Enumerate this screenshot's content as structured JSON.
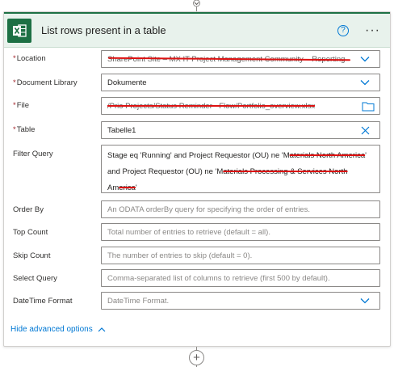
{
  "card": {
    "title": "List rows present in a table",
    "help_icon": "question-circle-icon",
    "more_icon": "ellipsis-icon",
    "accent_color": "#1d7044"
  },
  "fields": {
    "location": {
      "label": "Location",
      "value": "SharePoint Site – MX IT Project Management Community – Reporting",
      "required": true
    },
    "document_library": {
      "label": "Document Library",
      "value": "Dokumente",
      "required": true
    },
    "file": {
      "label": "File",
      "value": "/Prio Projects/Status Reminder - Flow/Portfolio_overview.xlsx",
      "required": true
    },
    "table": {
      "label": "Table",
      "value": "Tabelle1",
      "required": true
    },
    "filter_query": {
      "label": "Filter Query",
      "line1_a": "Stage eq 'Running' and Project Requestor (OU) ne '",
      "line1_b": "M",
      "line1_c": "aterials North America",
      "line1_d": "'",
      "line2_a": "and Project Requestor (OU) ne '",
      "line2_b": "M",
      "line2_c": "aterials Processing & Services North",
      "line3_a": "Am",
      "line3_b": "erica",
      "line3_c": "'"
    },
    "order_by": {
      "label": "Order By",
      "placeholder": "An ODATA orderBy query for specifying the order of entries."
    },
    "top_count": {
      "label": "Top Count",
      "placeholder": "Total number of entries to retrieve (default = all)."
    },
    "skip_count": {
      "label": "Skip Count",
      "placeholder": "The number of entries to skip (default = 0)."
    },
    "select_query": {
      "label": "Select Query",
      "placeholder": "Comma-separated list of columns to retrieve (first 500 by default)."
    },
    "datetime_format": {
      "label": "DateTime Format",
      "placeholder": "DateTime Format."
    }
  },
  "footer": {
    "hide_advanced": "Hide advanced options"
  },
  "required_marker": "*",
  "add_step_icon": "plus-icon"
}
